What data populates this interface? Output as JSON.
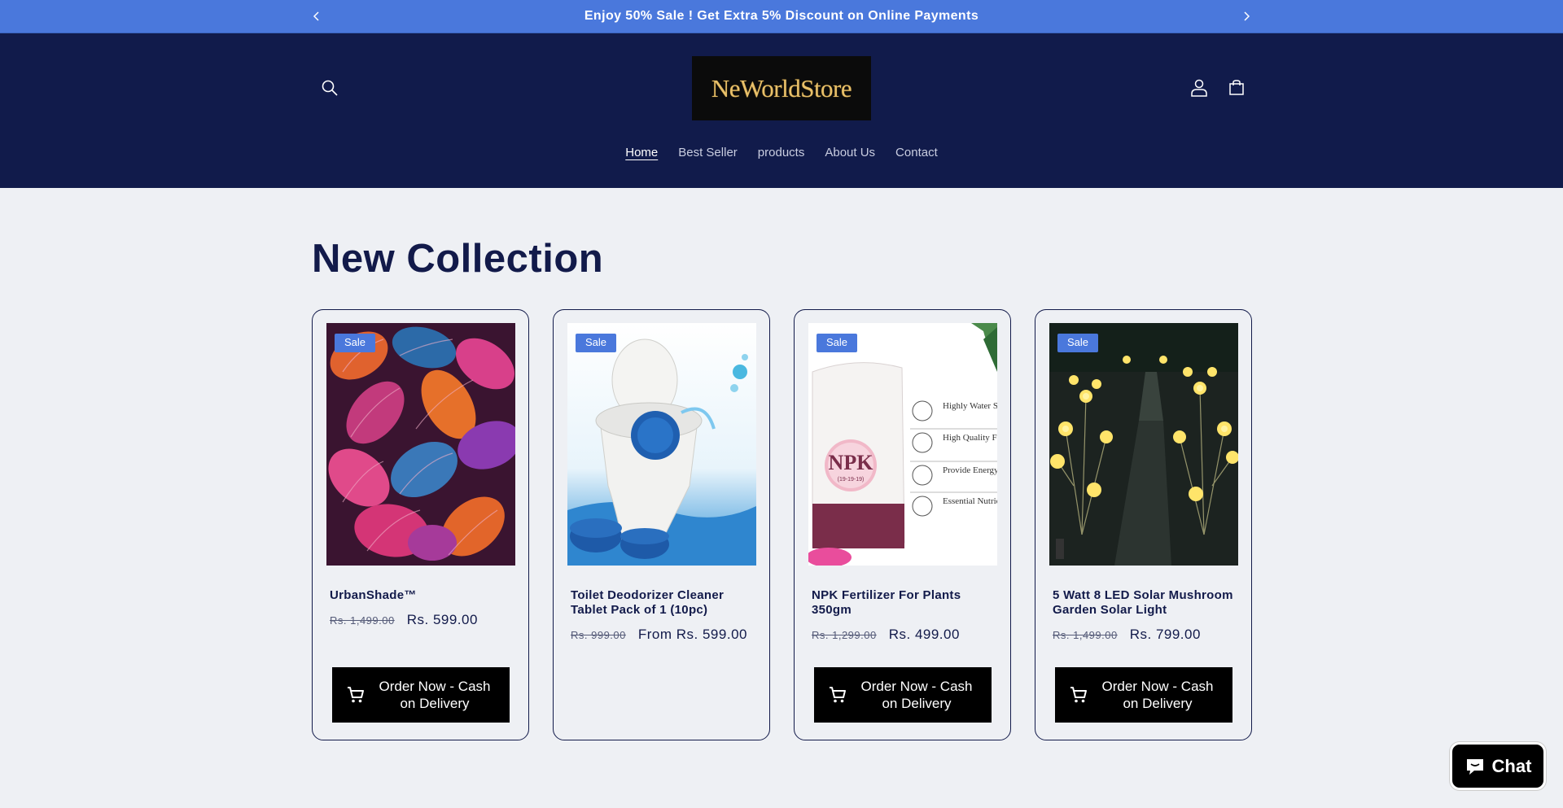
{
  "announcement": {
    "text": "Enjoy 50% Sale ! Get Extra 5% Discount on Online Payments",
    "prev_icon": "chevron-left-icon",
    "next_icon": "chevron-right-icon"
  },
  "header": {
    "logo_text": "NeWorldStore",
    "icons": [
      "search-icon",
      "account-icon",
      "cart-icon"
    ],
    "nav": [
      {
        "label": "Home",
        "active": true
      },
      {
        "label": "Best Seller",
        "active": false
      },
      {
        "label": "products",
        "active": false
      },
      {
        "label": "About Us",
        "active": false
      },
      {
        "label": "Contact",
        "active": false
      }
    ]
  },
  "collection": {
    "title": "New Collection",
    "products": [
      {
        "badge": "Sale",
        "title": "UrbanShade™",
        "price_old": "Rs. 1,499.00",
        "price_new": "Rs. 599.00",
        "button": "Order Now - Cash on Delivery"
      },
      {
        "badge": "Sale",
        "title": "Toilet Deodorizer Cleaner Tablet Pack of 1 (10pc)",
        "price_old": "Rs. 999.00",
        "price_new": "From Rs. 599.00",
        "button": ""
      },
      {
        "badge": "Sale",
        "title": "NPK Fertilizer For Plants 350gm",
        "price_old": "Rs. 1,299.00",
        "price_new": "Rs. 499.00",
        "button": "Order Now - Cash on Delivery"
      },
      {
        "badge": "Sale",
        "title": "5 Watt 8 LED Solar Mushroom Garden Solar Light",
        "price_old": "Rs. 1,499.00",
        "price_new": "Rs. 799.00",
        "button": "Order Now - Cash on Delivery"
      }
    ]
  },
  "npk_image": {
    "label": "NPK",
    "sublabel": "(19-19-19)",
    "features": [
      "Highly Water Soluble",
      "High Quality Fertilizer",
      "Provide Energy to Plant",
      "Essential Nutrients"
    ]
  },
  "chat": {
    "label": "Chat",
    "icon": "chat-bubble-icon"
  },
  "colors": {
    "accent": "#4a78dc",
    "header_bg": "#111b4b",
    "page_bg": "#eef0f4",
    "button_bg": "#000000"
  }
}
